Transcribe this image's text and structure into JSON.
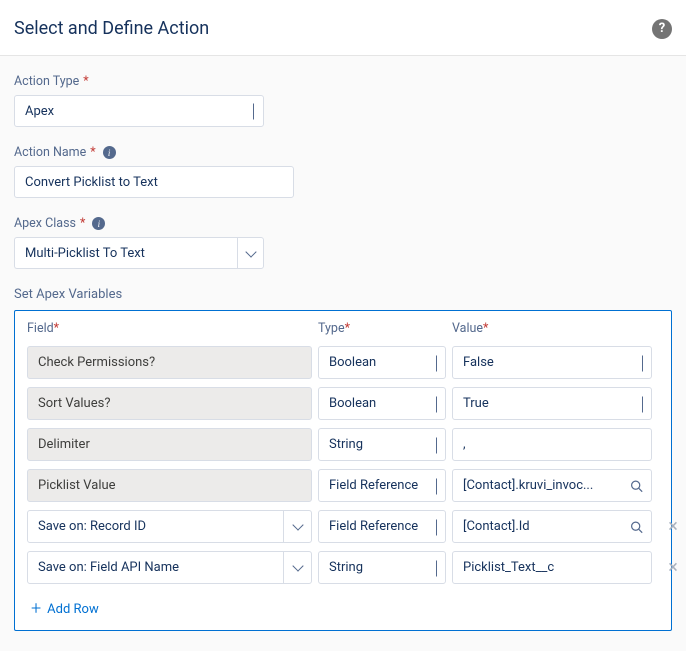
{
  "header": {
    "title": "Select and Define Action"
  },
  "actionType": {
    "label": "Action Type",
    "value": "Apex"
  },
  "actionName": {
    "label": "Action Name",
    "value": "Convert Picklist to Text"
  },
  "apexClass": {
    "label": "Apex Class",
    "value": "Multi-Picklist To Text"
  },
  "variables": {
    "sectionTitle": "Set Apex Variables",
    "headers": {
      "field": "Field",
      "type": "Type",
      "value": "Value"
    },
    "rows": [
      {
        "field": "Check Permissions?",
        "fieldEditable": false,
        "type": "Boolean",
        "value": "False",
        "valueMode": "select",
        "removable": false
      },
      {
        "field": "Sort Values?",
        "fieldEditable": false,
        "type": "Boolean",
        "value": "True",
        "valueMode": "select",
        "removable": false
      },
      {
        "field": "Delimiter",
        "fieldEditable": false,
        "type": "String",
        "value": ",",
        "valueMode": "text",
        "removable": false
      },
      {
        "field": "Picklist Value",
        "fieldEditable": false,
        "type": "Field Reference",
        "value": "[Contact].kruvi_invoc...",
        "valueMode": "lookup",
        "removable": false
      },
      {
        "field": "Save on: Record ID",
        "fieldEditable": true,
        "type": "Field Reference",
        "value": "[Contact].Id",
        "valueMode": "lookup",
        "removable": true
      },
      {
        "field": "Save on: Field API Name",
        "fieldEditable": true,
        "type": "String",
        "value": "Picklist_Text__c",
        "valueMode": "text",
        "removable": true
      }
    ],
    "addRowLabel": "Add Row"
  }
}
